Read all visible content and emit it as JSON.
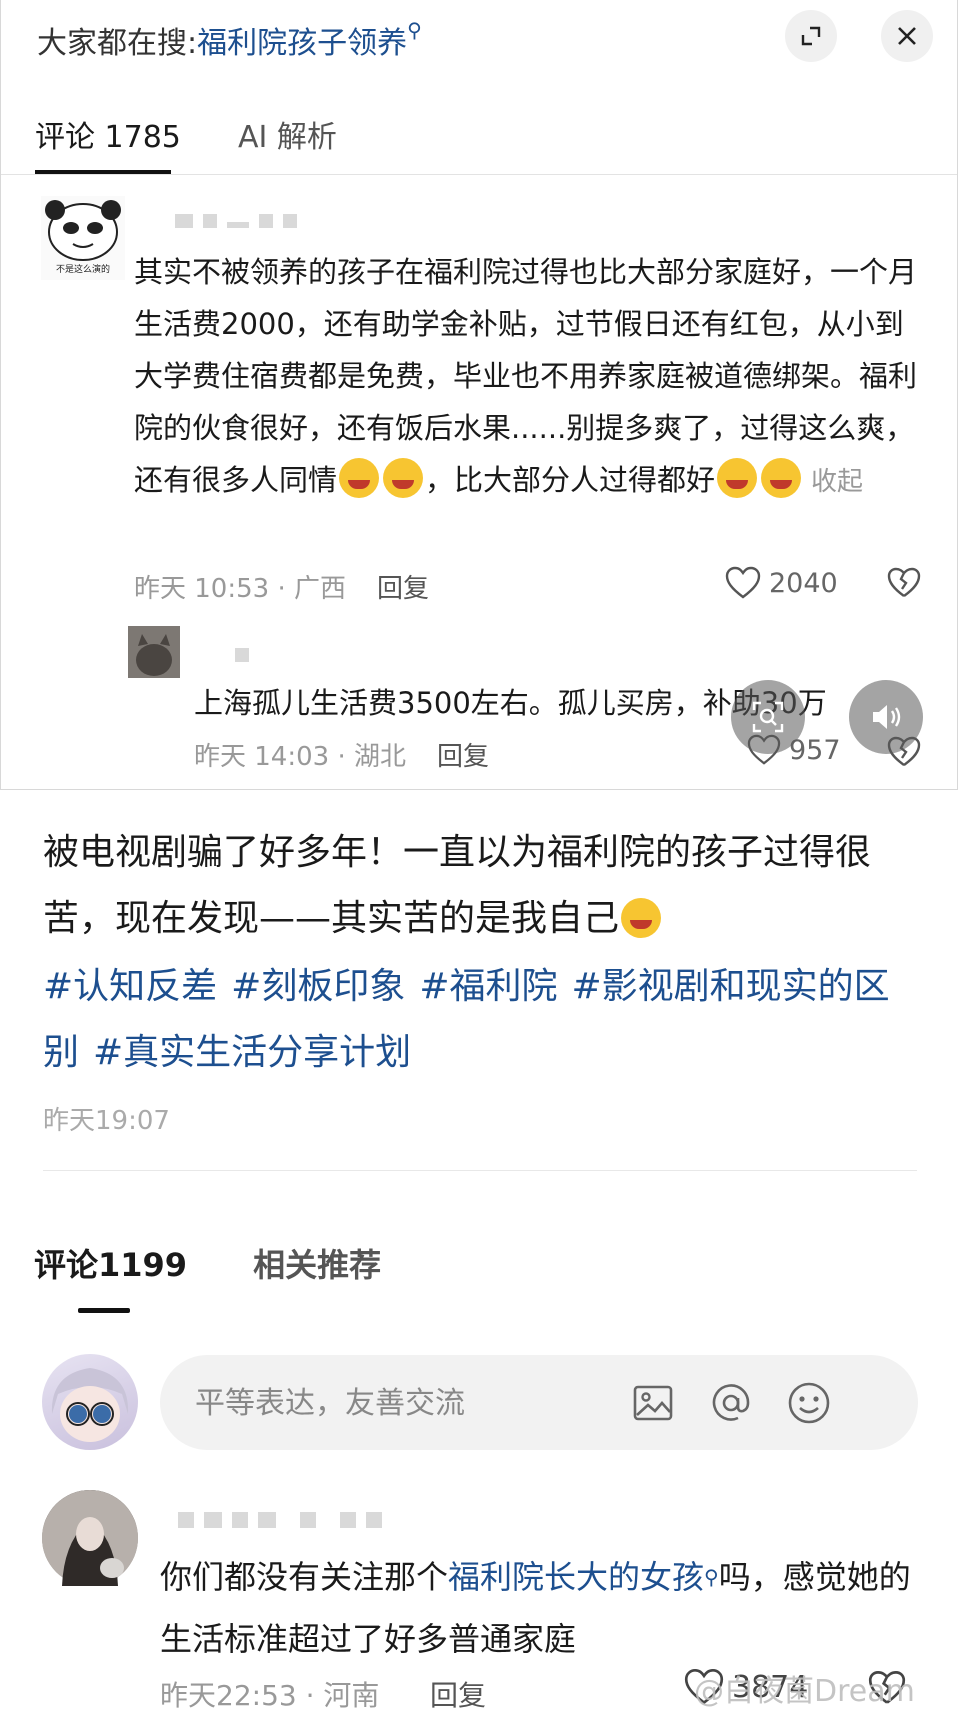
{
  "embedded": {
    "hot_search_prefix": "大家都在搜:",
    "hot_search_keyword": "福利院孩子领养",
    "tabs": {
      "comments": "评论 1785",
      "ai": "AI 解析"
    },
    "comment1": {
      "text": "其实不被领养的孩子在福利院过得也比大部分家庭好，一个月生活费2000，还有助学金补贴，过节假日还有红包，从小到大学费住宿费都是免费，毕业也不用养家庭被道德绑架。福利院的伙食很好，还有饭后水果......别提多爽了，过得这么爽，还有很多人同情",
      "text_tail_1": "，比大部分人过得都好",
      "collapse": "收起",
      "time": "昨天 10:53 · 广西",
      "reply": "回复",
      "likes": "2040",
      "avatar_caption": "不是这么演的"
    },
    "comment2": {
      "text": "上海孤儿生活费3500左右。孤儿买房，补助30万",
      "time": "昨天 14:03 · 湖北",
      "reply": "回复",
      "likes": "957"
    }
  },
  "post": {
    "text": "被电视剧骗了好多年！一直以为福利院的孩子过得很苦，现在发现——其实苦的是我自己",
    "hashtags": [
      "#认知反差",
      "#刻板印象",
      "#福利院",
      "#影视剧和现实的区别",
      "#真实生活分享计划"
    ],
    "time": "昨天19:07"
  },
  "comments_section": {
    "tabs": {
      "comments": "评论1199",
      "related": "相关推荐"
    },
    "input_placeholder": "平等表达，友善交流",
    "comment": {
      "text_before": "你们都没有关注那个",
      "keyword": "福利院长大的女孩",
      "text_after": "吗，感觉她的生活标准超过了好多普通家庭",
      "time": "昨天22:53 · 河南",
      "reply": "回复",
      "likes": "3874"
    }
  },
  "watermark": "@白夜菌Dream",
  "icons": {
    "expand": "expand-icon",
    "close": "close-icon",
    "search_small": "search-icon",
    "heart": "heart-icon",
    "dislike": "broken-heart-icon",
    "image": "image-icon",
    "at": "at-icon",
    "emoji": "emoji-icon",
    "lens": "lens-search-icon",
    "speaker": "speaker-icon"
  },
  "colors": {
    "link": "#1d4f8f",
    "meta": "#999999",
    "accent_underline": "#111111"
  }
}
